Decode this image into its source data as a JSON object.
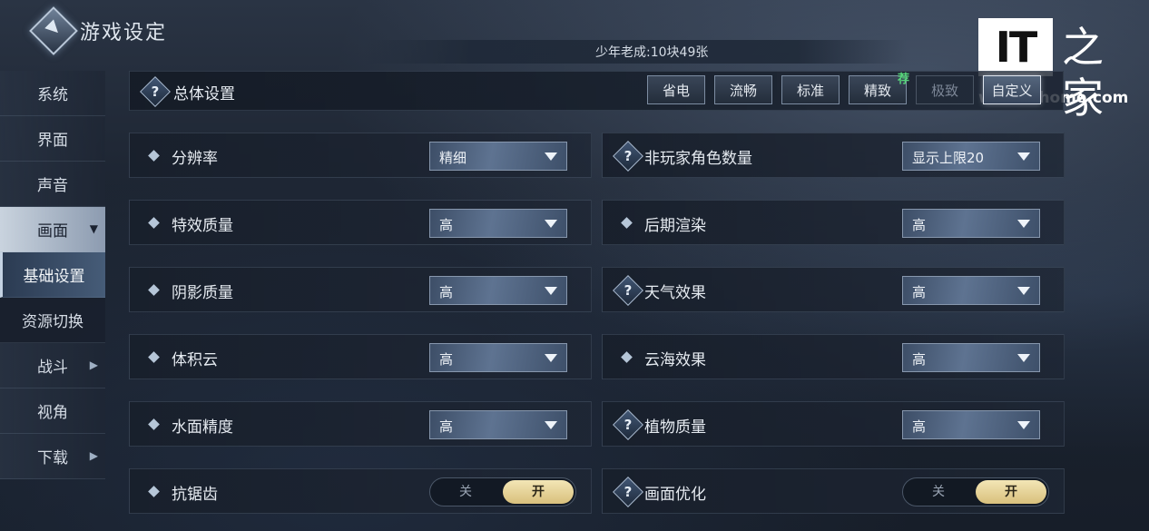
{
  "header": {
    "title": "游戏设定",
    "subtitle": "少年老成:10块49张"
  },
  "watermark": {
    "brand": "IT",
    "brand_cn": "之家",
    "url": "www.ithome.com"
  },
  "sidebar": {
    "items": [
      {
        "label": "系统"
      },
      {
        "label": "界面"
      },
      {
        "label": "声音"
      },
      {
        "label": "画面"
      },
      {
        "label": "基础设置"
      },
      {
        "label": "资源切换"
      },
      {
        "label": "战斗"
      },
      {
        "label": "视角"
      },
      {
        "label": "下载"
      }
    ]
  },
  "overall": {
    "label": "总体设置",
    "presets": [
      {
        "label": "省电"
      },
      {
        "label": "流畅"
      },
      {
        "label": "标准"
      },
      {
        "label": "精致",
        "badge": "荐"
      },
      {
        "label": "极致"
      },
      {
        "label": "自定义"
      }
    ]
  },
  "settings": {
    "left": [
      {
        "label": "分辨率",
        "value": "精细"
      },
      {
        "label": "特效质量",
        "value": "高"
      },
      {
        "label": "阴影质量",
        "value": "高"
      },
      {
        "label": "体积云",
        "value": "高"
      },
      {
        "label": "水面精度",
        "value": "高"
      },
      {
        "label": "抗锯齿",
        "off": "关",
        "on": "开"
      }
    ],
    "right": [
      {
        "label": "非玩家角色数量",
        "value": "显示上限20"
      },
      {
        "label": "后期渲染",
        "value": "高"
      },
      {
        "label": "天气效果",
        "value": "高"
      },
      {
        "label": "云海效果",
        "value": "高"
      },
      {
        "label": "植物质量",
        "value": "高"
      },
      {
        "label": "画面优化",
        "off": "关",
        "on": "开"
      }
    ]
  },
  "icons": {
    "help": "?",
    "arrow_right": "›",
    "arrow_down": "⌄"
  },
  "colors": {
    "accent_toggle_on": "#d9c07c",
    "recommend_badge": "#56d47a"
  }
}
